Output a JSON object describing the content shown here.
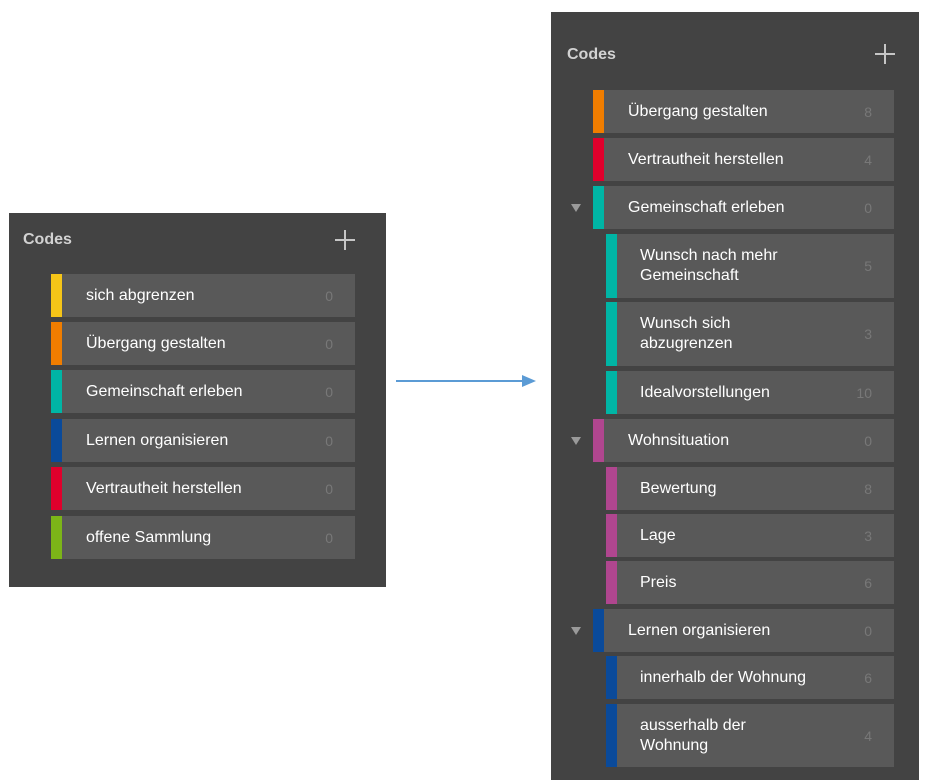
{
  "left_panel": {
    "title": "Codes",
    "add_icon": "plus-icon",
    "codes": [
      {
        "label": "sich abgrenzen",
        "count": "0",
        "color": "#f5c518"
      },
      {
        "label": "Übergang gestalten",
        "count": "0",
        "color": "#f07d00"
      },
      {
        "label": "Gemeinschaft erleben",
        "count": "0",
        "color": "#00b5a5"
      },
      {
        "label": "Lernen organisieren",
        "count": "0",
        "color": "#0a4a9a"
      },
      {
        "label": "Vertrautheit herstellen",
        "count": "0",
        "color": "#e0002c"
      },
      {
        "label": "offene Sammlung",
        "count": "0",
        "color": "#7cb518"
      }
    ]
  },
  "arrow_icon": "right-arrow-icon",
  "right_panel": {
    "title": "Codes",
    "add_icon": "plus-icon",
    "codes": [
      {
        "label": "Übergang gestalten",
        "count": "8",
        "color": "#f07d00",
        "level": 0
      },
      {
        "label": "Vertrautheit herstellen",
        "count": "4",
        "color": "#e0002c",
        "level": 0
      },
      {
        "label": "Gemeinschaft erleben",
        "count": "0",
        "color": "#00b5a5",
        "level": 0,
        "expanded": true
      },
      {
        "label": "Wunsch nach mehr Gemeinschaft",
        "count": "5",
        "color": "#00b5a5",
        "level": 1
      },
      {
        "label": "Wunsch sich abzugrenzen",
        "count": "3",
        "color": "#00b5a5",
        "level": 1
      },
      {
        "label": "Idealvorstellungen",
        "count": "10",
        "color": "#00b5a5",
        "level": 1
      },
      {
        "label": "Wohnsituation",
        "count": "0",
        "color": "#b0468f",
        "level": 0,
        "expanded": true
      },
      {
        "label": "Bewertung",
        "count": "8",
        "color": "#b0468f",
        "level": 1
      },
      {
        "label": "Lage",
        "count": "3",
        "color": "#b0468f",
        "level": 1
      },
      {
        "label": "Preis",
        "count": "6",
        "color": "#b0468f",
        "level": 1
      },
      {
        "label": "Lernen organisieren",
        "count": "0",
        "color": "#0a4a9a",
        "level": 0,
        "expanded": true
      },
      {
        "label": "innerhalb der Wohnung",
        "count": "6",
        "color": "#0a4a9a",
        "level": 1
      },
      {
        "label": "ausserhalb der Wohnung",
        "count": "4",
        "color": "#0a4a9a",
        "level": 1
      }
    ]
  }
}
